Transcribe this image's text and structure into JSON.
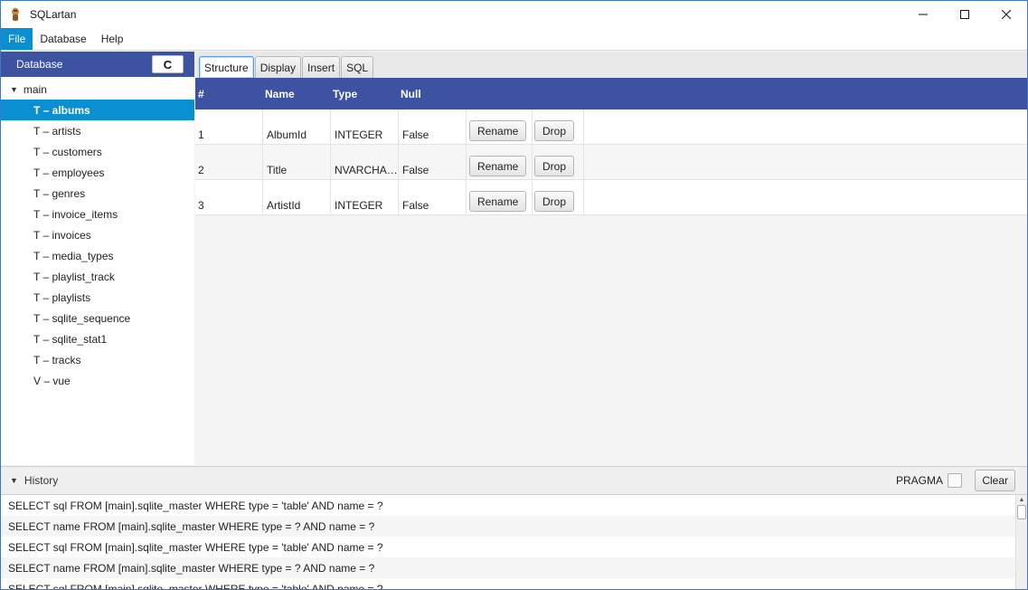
{
  "window": {
    "title": "SQLartan"
  },
  "menu": [
    "File",
    "Database",
    "Help"
  ],
  "left_panel": {
    "header": "Database",
    "refresh_label": "C",
    "root": "main",
    "items": [
      {
        "label": "T – albums",
        "selected": true
      },
      {
        "label": "T – artists"
      },
      {
        "label": "T – customers"
      },
      {
        "label": "T – employees"
      },
      {
        "label": "T – genres"
      },
      {
        "label": "T – invoice_items"
      },
      {
        "label": "T – invoices"
      },
      {
        "label": "T – media_types"
      },
      {
        "label": "T – playlist_track"
      },
      {
        "label": "T – playlists"
      },
      {
        "label": "T – sqlite_sequence"
      },
      {
        "label": "T – sqlite_stat1"
      },
      {
        "label": "T – tracks"
      },
      {
        "label": "V – vue"
      }
    ]
  },
  "tabs": [
    "Structure",
    "Display",
    "Insert",
    "SQL"
  ],
  "active_tab": "Structure",
  "table": {
    "headers": [
      "#",
      "Name",
      "Type",
      "Null"
    ],
    "rows": [
      {
        "num": "1",
        "name": "AlbumId",
        "type": "INTEGER",
        "null": "False"
      },
      {
        "num": "2",
        "name": "Title",
        "type": "NVARCHA…",
        "null": "False"
      },
      {
        "num": "3",
        "name": "ArtistId",
        "type": "INTEGER",
        "null": "False"
      }
    ],
    "rename_label": "Rename",
    "drop_label": "Drop"
  },
  "history": {
    "label": "History",
    "pragma_label": "PRAGMA",
    "clear_label": "Clear",
    "entries": [
      "SELECT sql FROM [main].sqlite_master WHERE type = 'table' AND name = ?",
      "SELECT name FROM [main].sqlite_master WHERE type = ? AND name = ?",
      "SELECT sql FROM [main].sqlite_master WHERE type = 'table' AND name = ?",
      "SELECT name FROM [main].sqlite_master WHERE type = ? AND name = ?",
      "SELECT sql FROM [main].sqlite_master WHERE type = 'table' AND name = ?"
    ]
  },
  "colors": {
    "header_blue": "#3d52a0",
    "accent_blue": "#0a8fd0"
  }
}
